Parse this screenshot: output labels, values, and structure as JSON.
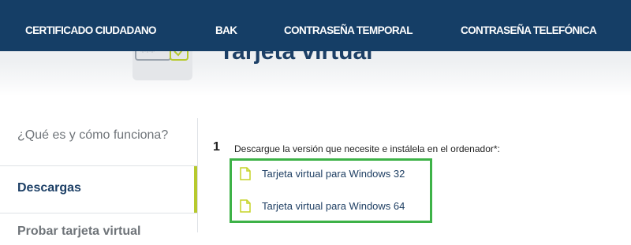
{
  "nav": {
    "items": [
      {
        "label": "CERTIFICADO CIUDADANO"
      },
      {
        "label": "BAK"
      },
      {
        "label": "CONTRASEÑA TEMPORAL"
      },
      {
        "label": "CONTRASEÑA TELEFÓNICA"
      }
    ]
  },
  "hero": {
    "title": "Tarjeta virtual",
    "icon": "virtual-card-icon"
  },
  "sidebar": {
    "items": [
      {
        "label": "¿Qué es y cómo funciona?",
        "active": false
      },
      {
        "label": "Descargas",
        "active": true
      },
      {
        "label": "Probar tarjeta virtual",
        "active": false
      }
    ]
  },
  "main": {
    "step_number": "1",
    "step_text": "Descargue la versión que necesite e instálela en el ordenador*:",
    "links": [
      {
        "label": "Tarjeta virtual para Windows 32",
        "icon": "file-icon"
      },
      {
        "label": "Tarjeta virtual para Windows 64",
        "icon": "file-icon"
      }
    ]
  },
  "colors": {
    "nav_bg": "#153e66",
    "accent_green": "#b6c92d",
    "highlight_green": "#3db247",
    "file_icon": "#c5d326",
    "text_dark_blue": "#1c3f66"
  }
}
